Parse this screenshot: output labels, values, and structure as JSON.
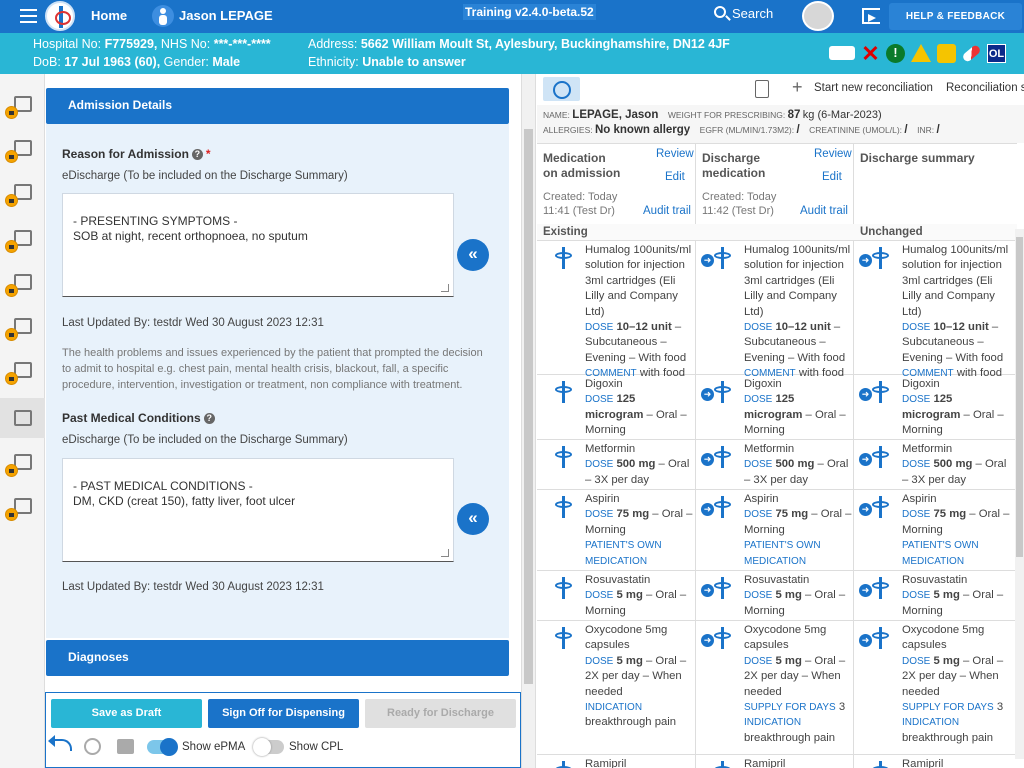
{
  "topbar": {
    "home_label": "Home",
    "patient_name": "Jason LEPAGE",
    "training_label": "Training v2.4.0-beta.52",
    "search_label": "Search",
    "help_label": "HELP & FEEDBACK"
  },
  "banner": {
    "hospital_label": "Hospital No:",
    "hospital_value": "F775929,",
    "nhs_label": "NHS No:",
    "nhs_value": "***-***-****",
    "dob_label": "DoB:",
    "dob_value": "17 Jul 1963 (60),",
    "gender_label": "Gender:",
    "gender_value": "Male",
    "address_label": "Address:",
    "address_value": "5662 William Moult St, Aylesbury, Buckinghamshire, DN12 4JF",
    "ethnicity_label": "Ethnicity:",
    "ethnicity_value": "Unable to answer",
    "ol_badge": "OL",
    "stop_glyph": "!"
  },
  "admission": {
    "header": "Admission Details",
    "reason_label": "Reason for Admission",
    "required_mark": "*",
    "edischarge_note": "eDischarge (To be included on the Discharge Summary)",
    "reason_text": " - PRESENTING SYMPTOMS -\nSOB at night, recent orthopnoea, no sputum",
    "reason_updated": "Last Updated By: testdr Wed 30 August 2023 12:31",
    "reason_help": "The health problems and issues experienced by the patient that prompted the decision to admit to hospital e.g. chest pain, mental health crisis, blackout, fall,  a specific procedure, intervention, investigation or treatment, non compliance with treatment.",
    "pmc_label": "Past Medical Conditions",
    "pmc_text": " - PAST MEDICAL CONDITIONS -\nDM, CKD (creat 150), fatty liver, foot ulcer",
    "pmc_updated": "Last Updated By: testdr Wed 30 August 2023 12:31",
    "copy_glyph": "«",
    "help_glyph": "?"
  },
  "diagnoses": {
    "header": "Diagnoses"
  },
  "actions": {
    "draft": "Save as Draft",
    "sign": "Sign Off for Dispensing",
    "ready": "Ready for Discharge",
    "show_epma": "Show ePMA",
    "show_cpl": "Show CPL",
    "epma_on": true,
    "cpl_on": false
  },
  "rtoolbar": {
    "start": "Start new reconciliation",
    "status": "Reconciliation st"
  },
  "patient_info": {
    "name_label": "NAME:",
    "name": "LEPAGE, Jason",
    "weight_label": "WEIGHT FOR PRESCRIBING:",
    "weight_value": "87",
    "weight_unit": "kg (6-Mar-2023)",
    "allergies_label": "ALLERGIES:",
    "allergies": "No known allergy",
    "egfr_label": "EGFR (ML/MIN/1.73M2):",
    "egfr_value": "/",
    "creat_label": "CREATININE (UMOL/L):",
    "creat_value": "/",
    "inr_label": "INR:",
    "inr_value": "/"
  },
  "columns": [
    {
      "title": "Medication on admission",
      "review": "Review",
      "edit": "Edit",
      "created": "Created: Today",
      "time": "11:41 (Test Dr)",
      "audit": "Audit trail"
    },
    {
      "title": "Discharge medication",
      "review": "Review",
      "edit": "Edit",
      "created": "Created: Today",
      "time": "11:42 (Test Dr)",
      "audit": "Audit trail"
    },
    {
      "title": "Discharge summary"
    }
  ],
  "groups": {
    "existing": "Existing",
    "unchanged": "Unchanged"
  },
  "meds": [
    {
      "name": "Humalog 100units/ml solution for injection 3ml cartridges (Eli Lilly and Company Ltd)",
      "k1": "DOSE",
      "dose": "10–12 unit",
      "route": " – Subcutaneous – Evening – With food",
      "k2": "COMMENT",
      "extra": "with food"
    },
    {
      "name": "Digoxin",
      "k1": "DOSE",
      "dose": "125 microgram",
      "route": " – Oral – Morning"
    },
    {
      "name": "Metformin",
      "k1": "DOSE",
      "dose": "500 mg",
      "route": " – Oral – 3X per day"
    },
    {
      "name": "Aspirin",
      "k1": "DOSE",
      "dose": "75 mg",
      "route": " – Oral – Morning",
      "k2": "PATIENT'S OWN MEDICATION"
    },
    {
      "name": "Rosuvastatin",
      "k1": "DOSE",
      "dose": "5 mg",
      "route": " – Oral – Morning"
    },
    {
      "name": "Oxycodone 5mg capsules",
      "k1": "DOSE",
      "dose": "5 mg",
      "route": " – Oral – 2X per day – When needed",
      "k2": "INDICATION",
      "extra": "breakthrough pain"
    },
    {
      "name": "Ramipril"
    }
  ],
  "oxy_supply_label": "SUPPLY FOR DAYS",
  "oxy_supply_value": "3",
  "arrow_glyph": "➜"
}
